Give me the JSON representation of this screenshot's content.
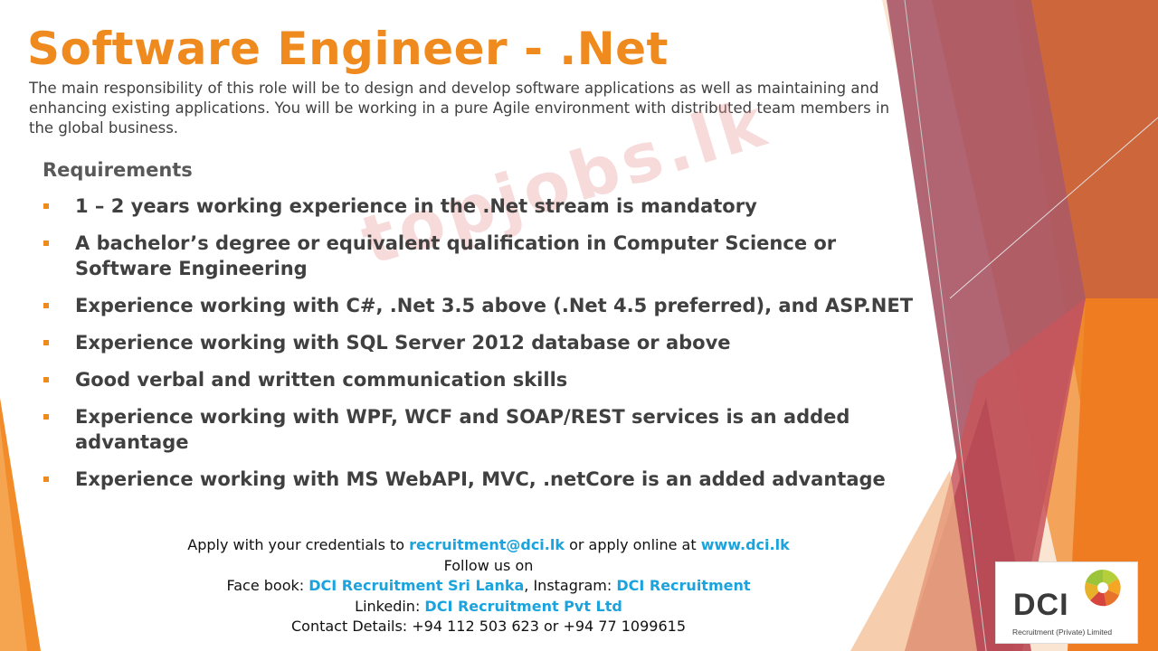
{
  "title": "Software Engineer - .Net",
  "intro": "The main responsibility of this role will be to design and develop software applications as well as maintaining and enhancing existing applications. You will be working in a pure Agile environment with distributed team members in the global business.",
  "requirements": {
    "heading": "Requirements",
    "items": [
      "1 – 2 years working experience in the .Net stream is mandatory",
      "A bachelor’s degree or equivalent qualification in Computer Science or Software Engineering",
      "Experience working with C#, .Net 3.5 above (.Net 4.5 preferred), and ASP.NET",
      "Experience working with SQL Server 2012 database or above",
      "Good verbal and written communication skills",
      "Experience working with WPF, WCF and SOAP/REST services is an added advantage",
      "Experience working with MS WebAPI, MVC, .netCore is an added advantage"
    ]
  },
  "watermark": "topjobs.lk",
  "footer": {
    "apply_prefix": "Apply with your credentials to ",
    "email": "recruitment@dci.lk",
    "apply_mid": " or apply online at ",
    "website": "www.dci.lk",
    "follow": "Follow us on",
    "facebook_label": "Face book: ",
    "facebook": "DCI Recruitment Sri Lanka",
    "instagram_label": ", Instagram: ",
    "instagram": "DCI Recruitment",
    "linkedin_label": "Linkedin: ",
    "linkedin": "DCI Recruitment Pvt Ltd",
    "contact": "Contact Details: +94 112 503 623 or +94 77 1099615"
  },
  "logo": {
    "name": "DCI",
    "tagline": "Recruitment (Private) Limited"
  },
  "colors": {
    "title": "#ef8a1f",
    "link": "#1ba3dd",
    "bullet": "#ef8a1f"
  }
}
